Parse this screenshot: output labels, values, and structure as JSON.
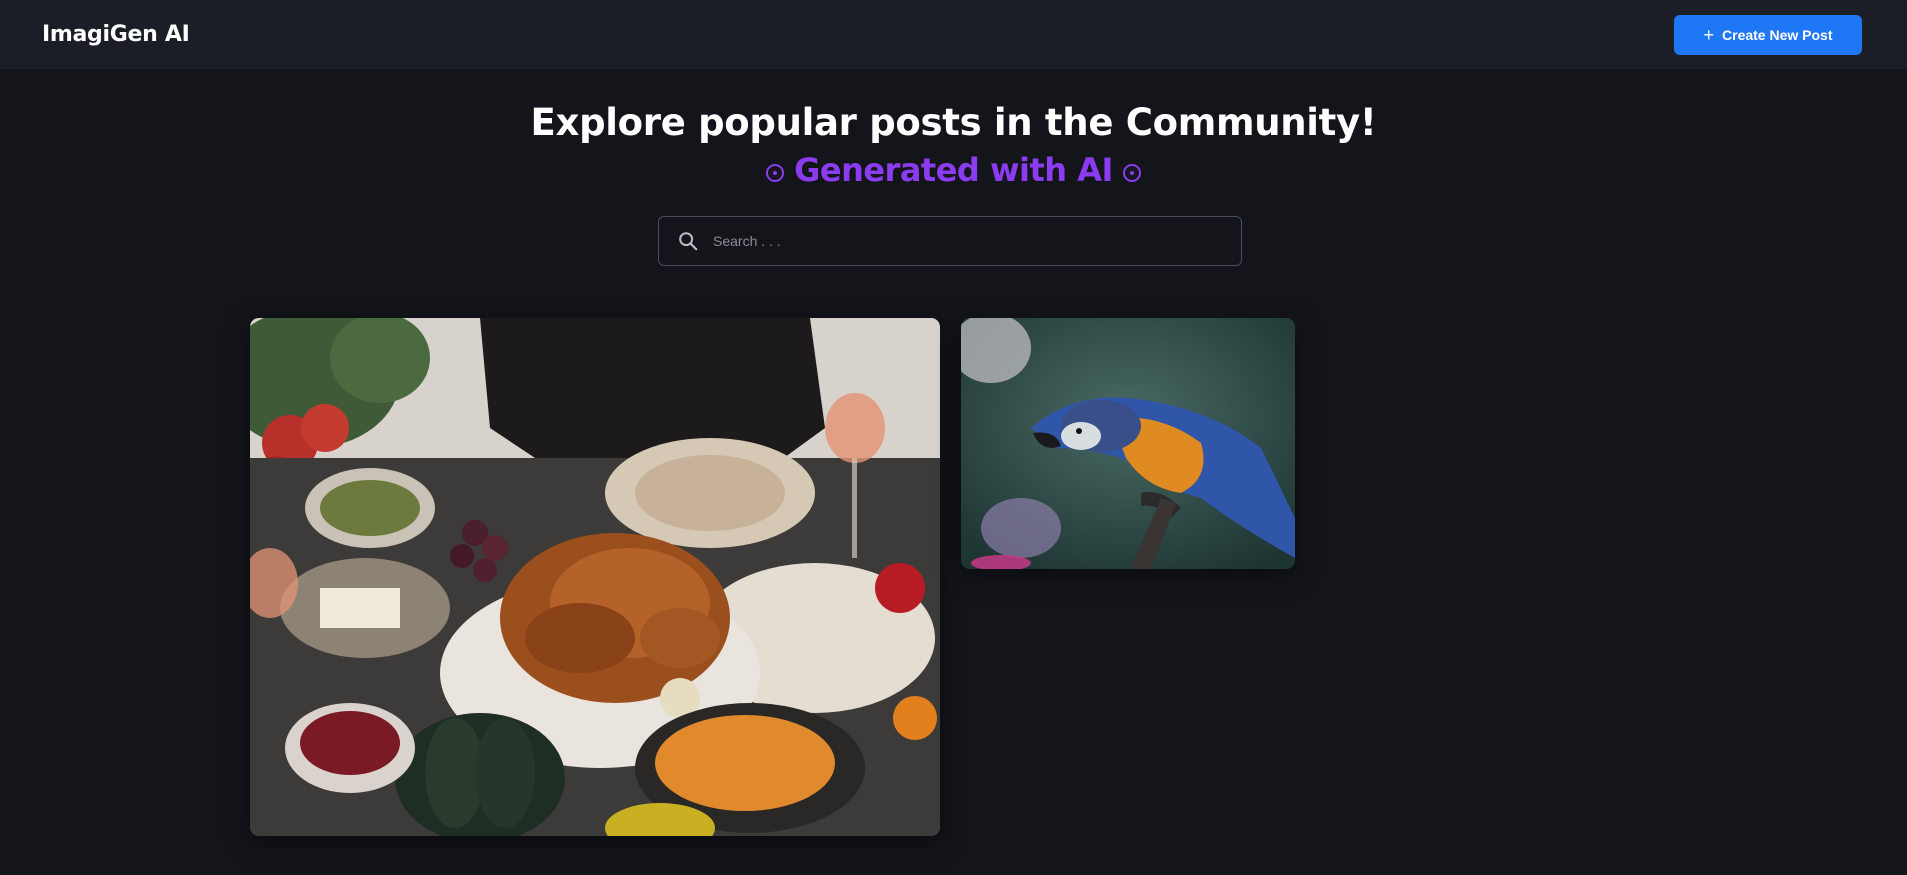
{
  "header": {
    "logo": "ImagiGen AI",
    "create_button_label": "Create New Post",
    "create_button_icon": "plus-icon"
  },
  "hero": {
    "title": "Explore popular posts in the Community!",
    "subtitle": "Generated with AI",
    "subtitle_icon": "target-icon",
    "accent_color": "#8b3cf0"
  },
  "search": {
    "placeholder": "Search . . .",
    "value": ""
  },
  "posts": [
    {
      "subject": "roast chicken dinner table"
    },
    {
      "subject": "blue and gold macaw parrot"
    }
  ],
  "colors": {
    "background": "#13151b",
    "header_background": "#1b1e26",
    "primary_button": "#1f77f6"
  }
}
